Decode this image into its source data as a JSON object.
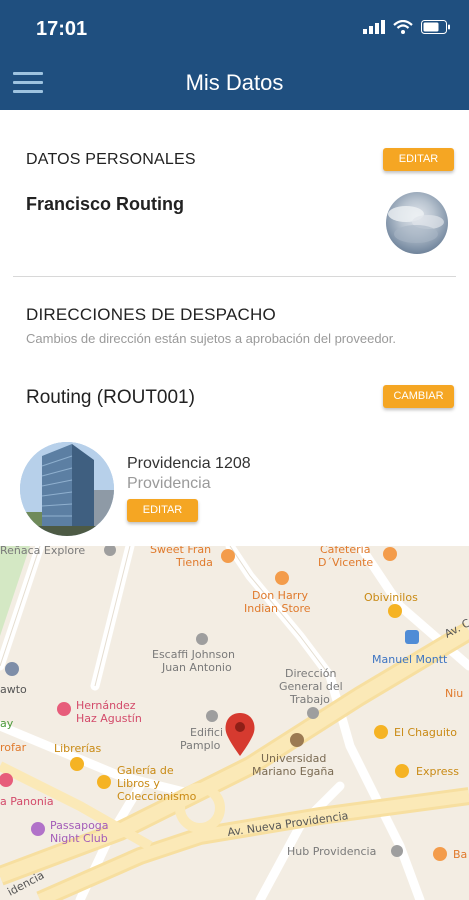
{
  "status_bar": {
    "time": "17:01"
  },
  "header": {
    "title": "Mis Datos"
  },
  "personal": {
    "section_title": "DATOS PERSONALES",
    "edit_label": "EDITAR",
    "name": "Francisco Routing"
  },
  "addresses": {
    "section_title": "DIRECCIONES DE DESPACHO",
    "hint": "Cambios de dirección están sujetos a aprobación del proveedor.",
    "route_name": "Routing (ROUT001)",
    "change_label": "CAMBIAR",
    "street": "Providencia 1208",
    "district": "Providencia",
    "edit_label": "EDITAR"
  },
  "map": {
    "labels": {
      "renaca": "Reñaca Explore",
      "sweet_1": "Sweet Fran",
      "sweet_2": "Tienda",
      "cafeteria_1": "Cafetería",
      "cafeteria_2": "D´Vicente",
      "donharry_1": "Don Harry",
      "donharry_2": "Indian Store",
      "obivinilos": "Obivinilos",
      "escaffi_1": "Escaffi Johnson",
      "escaffi_2": "Juan Antonio",
      "manuel": "Manuel Montt",
      "avenida_top": "Av. C",
      "direccion_1": "Dirección",
      "direccion_2": "General del",
      "direccion_3": "Trabajo",
      "hawto": "awto",
      "niu": "Niu",
      "hernandez_1": "Hernández",
      "hernandez_2": "Haz Agustín",
      "edificio_1": "Edifici",
      "edificio_2": "Pamplo",
      "universidad_1": "Universidad",
      "universidad_2": "Mariano Egaña",
      "chaguito": "El Chaguito",
      "ay": "ay",
      "librerias": "Librerías",
      "rofar": "rofar",
      "galeria_1": "Galería de",
      "galeria_2": "Libros y",
      "galeria_3": "Coleccionismo",
      "express": "Express",
      "panonia": "a Panonia",
      "passapoga_1": "Passapoga",
      "passapoga_2": "Night Club",
      "av_nueva": "Av. Nueva Providencia",
      "hub": "Hub Providencia",
      "ba": "Ba",
      "idencia": "idencia"
    }
  }
}
